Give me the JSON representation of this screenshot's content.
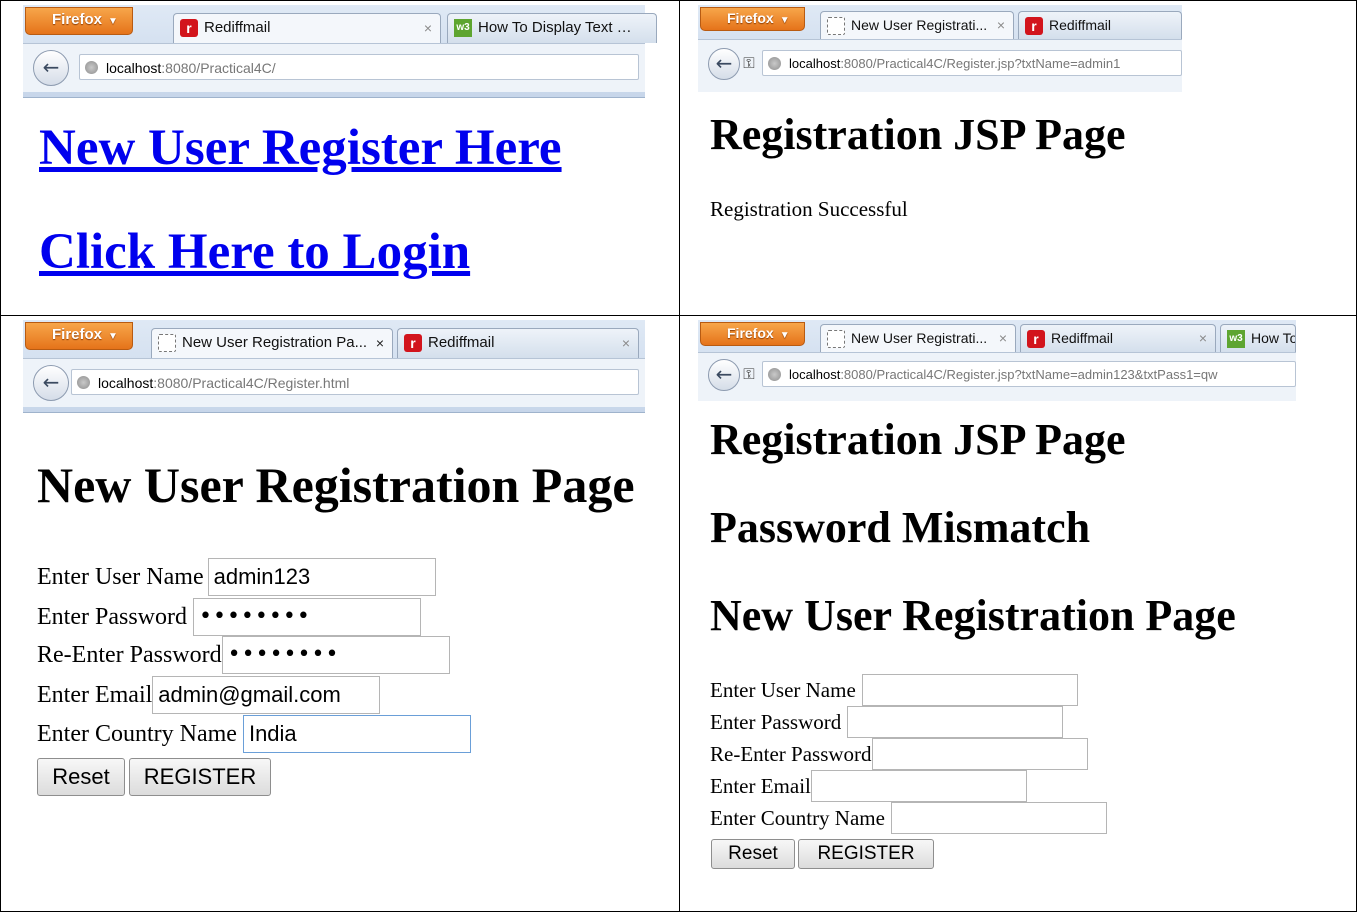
{
  "panel1": {
    "firefox_label": "Firefox",
    "tabs": [
      "Rediffmail",
      "How To Display Text …"
    ],
    "url_host": "localhost",
    "url_rest": ":8080/Practical4C/",
    "link_register": "New User Register Here",
    "link_login": "Click Here to Login"
  },
  "panel2": {
    "firefox_label": "Firefox",
    "tabs": [
      "New User Registrati...",
      "Rediffmail"
    ],
    "url_host": "localhost",
    "url_rest": ":8080/Practical4C/Register.jsp?txtName=admin1",
    "heading": "Registration JSP Page",
    "message": "Registration Successful"
  },
  "panel3": {
    "firefox_label": "Firefox",
    "tabs": [
      "New User Registration Pa...",
      "Rediffmail"
    ],
    "url_host": "localhost",
    "url_rest": ":8080/Practical4C/Register.html",
    "heading": "New User Registration Page",
    "fields": [
      {
        "label": "Enter User Name",
        "value": "admin123"
      },
      {
        "label": "Enter Password",
        "value": "••••••••"
      },
      {
        "label": "Re-Enter Password",
        "value": "••••••••"
      },
      {
        "label": "Enter Email",
        "value": "admin@gmail.com"
      },
      {
        "label": "Enter Country Name",
        "value": "India"
      }
    ],
    "reset_label": "Reset",
    "register_label": "REGISTER"
  },
  "panel4": {
    "firefox_label": "Firefox",
    "tabs": [
      "New User Registrati...",
      "Rediffmail",
      "How To"
    ],
    "url_host": "localhost",
    "url_rest": ":8080/Practical4C/Register.jsp?txtName=admin123&txtPass1=qw",
    "heading": "Registration JSP Page",
    "error": "Password Mismatch",
    "form_heading": "New User Registration Page",
    "fields": [
      {
        "label": "Enter User Name",
        "value": ""
      },
      {
        "label": "Enter Password",
        "value": ""
      },
      {
        "label": "Re-Enter Password",
        "value": ""
      },
      {
        "label": "Enter Email",
        "value": ""
      },
      {
        "label": "Enter Country Name",
        "value": ""
      }
    ],
    "reset_label": "Reset",
    "register_label": "REGISTER"
  }
}
